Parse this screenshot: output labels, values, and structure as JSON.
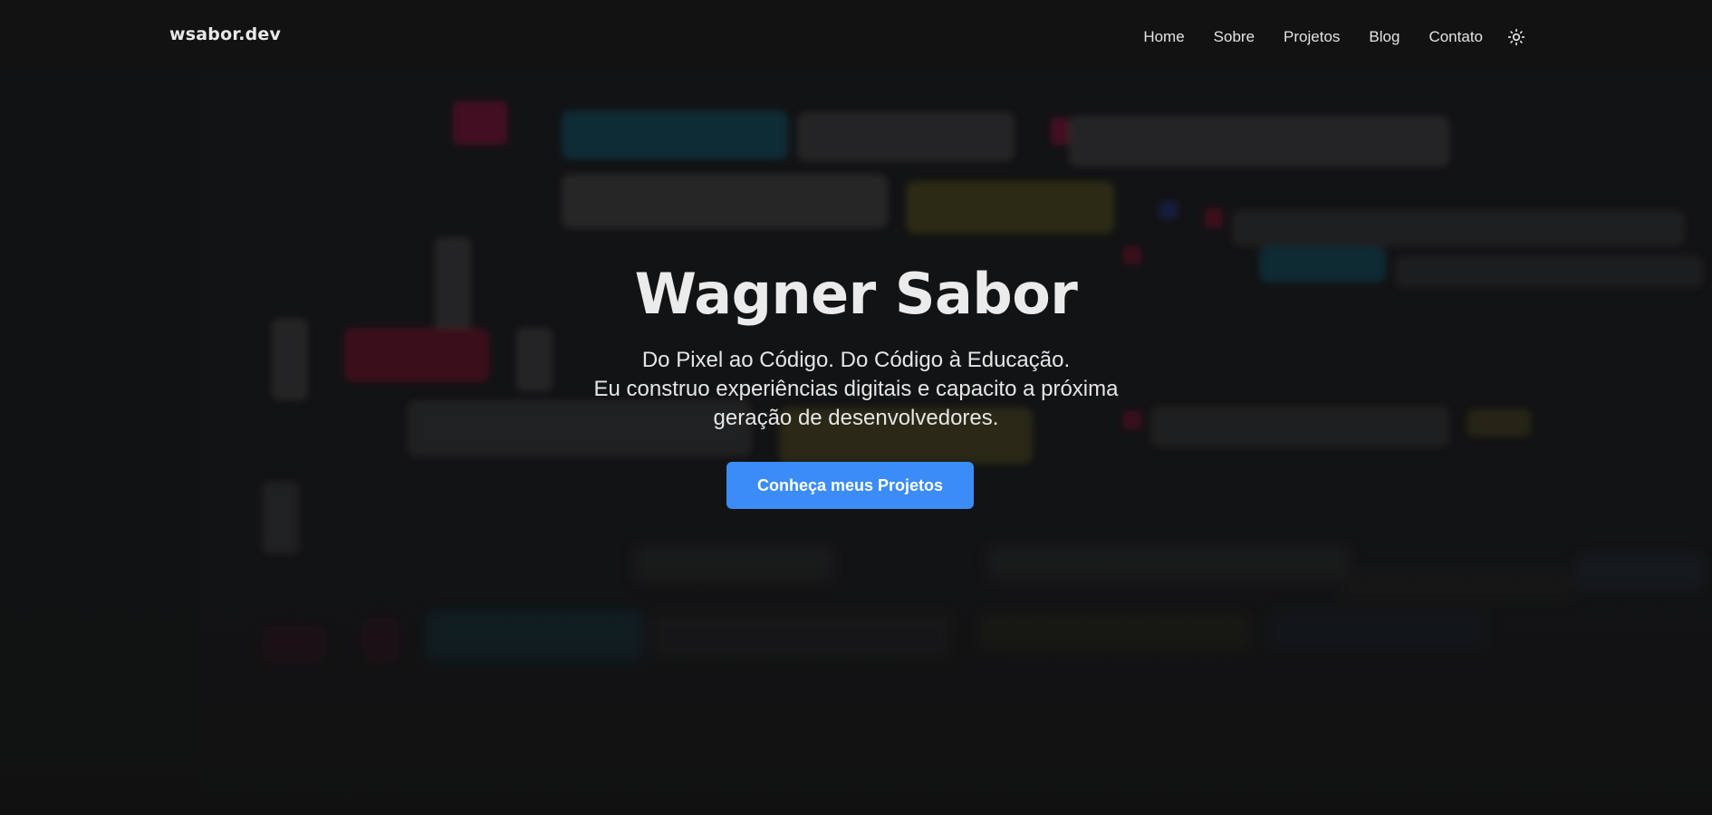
{
  "brand": "wsabor.dev",
  "nav": {
    "items": [
      {
        "label": "Home"
      },
      {
        "label": "Sobre"
      },
      {
        "label": "Projetos"
      },
      {
        "label": "Blog"
      },
      {
        "label": "Contato"
      }
    ],
    "theme_icon": "sun-icon"
  },
  "hero": {
    "title": "Wagner Sabor",
    "subtitle_lines": [
      "Do Pixel ao Código. Do Código à Educação.",
      "Eu construo experiências digitais e capacito a próxima",
      "geração de desenvolvedores."
    ],
    "cta_label": "Conheça meus Projetos"
  },
  "colors": {
    "background": "#111111",
    "accent": "#3b8cf7",
    "text": "#ebebeb"
  }
}
